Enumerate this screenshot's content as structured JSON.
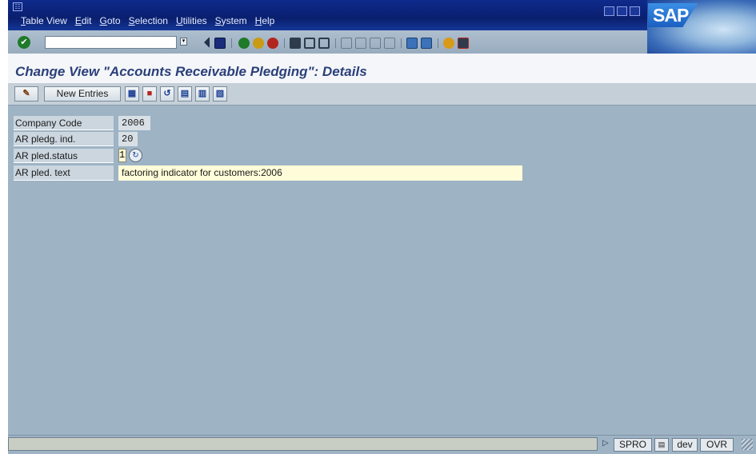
{
  "menubar": {
    "items": [
      "Table View",
      "Edit",
      "Goto",
      "Selection",
      "Utilities",
      "System",
      "Help"
    ],
    "logo": "SAP"
  },
  "toolbar": {
    "command_value": "",
    "icons": [
      "enter-icon",
      "save-icon",
      "back-icon",
      "exit-icon",
      "cancel-icon",
      "print-icon",
      "find-icon",
      "find-next-icon",
      "first-page-icon",
      "previous-page-icon",
      "next-page-icon",
      "last-page-icon",
      "create-session-icon",
      "shortcut-icon",
      "help-icon",
      "layout-menu-icon"
    ]
  },
  "title": "Change View \"Accounts Receivable Pledging\": Details",
  "app_toolbar": {
    "new_entries_label": "New Entries"
  },
  "form": {
    "company_code": {
      "label": "Company Code",
      "value": "2006"
    },
    "pledging_indicator": {
      "label": "AR pledg. ind.",
      "value": "20"
    },
    "pledging_status": {
      "label": "AR pled.status",
      "value": "1"
    },
    "pledging_text": {
      "label": "AR pled. text",
      "value": "factoring indicator for customers:2006"
    }
  },
  "statusbar": {
    "transaction": "SPRO",
    "system": "dev",
    "mode": "OVR"
  },
  "colors": {
    "menubar": "#0a1f6e",
    "background": "#9eb3c4",
    "title_text": "#2b3f7a",
    "input_fill": "#fffcd9"
  }
}
